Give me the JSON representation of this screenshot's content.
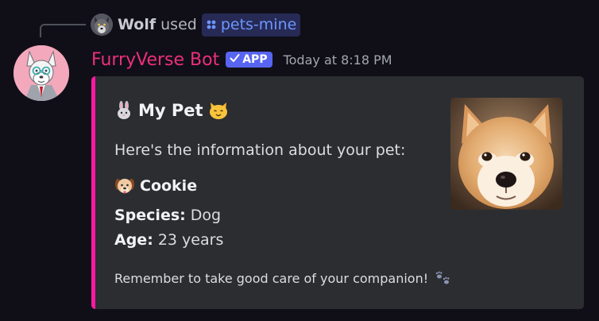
{
  "interaction": {
    "user": "Wolf",
    "verb": "used",
    "command": "pets-mine",
    "command_icon": "slash-command-icon"
  },
  "message": {
    "author": "FurryVerse Bot",
    "author_color": "#ec2f7a",
    "badge_label": "APP",
    "badge_icon": "check-icon",
    "badge_color": "#5865f2",
    "timestamp": "Today at 8:18 PM"
  },
  "embed": {
    "accent_color": "#ff1aa3",
    "title": "My Pet",
    "title_emoji_left": "rabbit-face-emoji",
    "title_emoji_right": "cat-face-emoji",
    "description": "Here's the information about your pet:",
    "pet_emoji": "dog-face-emoji",
    "pet_name": "Cookie",
    "fields": {
      "species_label": "Species:",
      "species_value": "Dog",
      "age_label": "Age:",
      "age_value": "23 years"
    },
    "footer_text": "Remember to take good care of your companion!",
    "footer_emoji": "paw-prints-emoji",
    "thumbnail": "shiba-dog-photo"
  }
}
